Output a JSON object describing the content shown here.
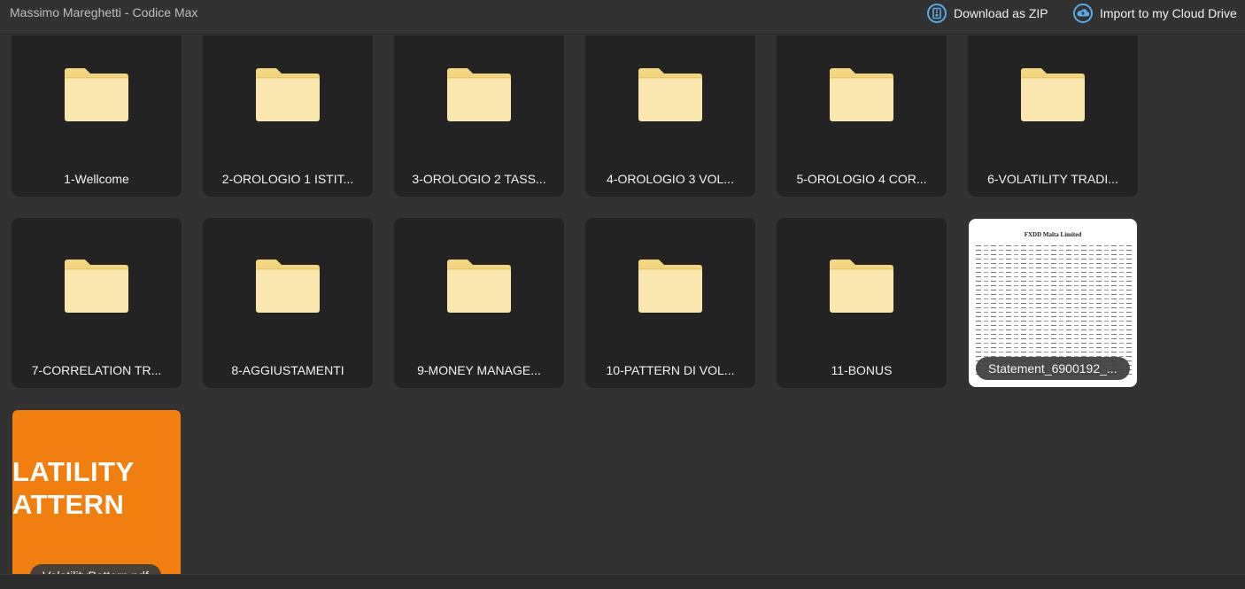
{
  "header": {
    "title": "Massimo Mareghetti - Codice Max",
    "actions": [
      {
        "label": "Download as ZIP",
        "icon": "zip-download-icon"
      },
      {
        "label": "Import to my Cloud Drive",
        "icon": "cloud-upload-icon"
      }
    ]
  },
  "colors": {
    "background": "#323232",
    "tile": "#232323",
    "folder_body": "#fbe8b0",
    "folder_tab": "#f5d680",
    "accent_icon": "#5aa9e6",
    "pdf_orange": "#f07f10"
  },
  "folders": [
    {
      "label": "1-Wellcome"
    },
    {
      "label": "2-OROLOGIO 1 ISTIT..."
    },
    {
      "label": "3-OROLOGIO 2 TASS..."
    },
    {
      "label": "4-OROLOGIO 3 VOL..."
    },
    {
      "label": "5-OROLOGIO 4 COR..."
    },
    {
      "label": "6-VOLATILITY TRADI..."
    },
    {
      "label": "7-CORRELATION TR..."
    },
    {
      "label": "8-AGGIUSTAMENTI"
    },
    {
      "label": "9-MONEY MANAGE..."
    },
    {
      "label": "10-PATTERN DI VOL..."
    },
    {
      "label": "11-BONUS"
    }
  ],
  "files": [
    {
      "label": "Statement_6900192_...",
      "thumb_title": "FXDD Malta Limited"
    },
    {
      "label": "VolatilityPattern.pdf",
      "thumb_line1": "LATILITY",
      "thumb_line2": "ATTERN"
    }
  ]
}
